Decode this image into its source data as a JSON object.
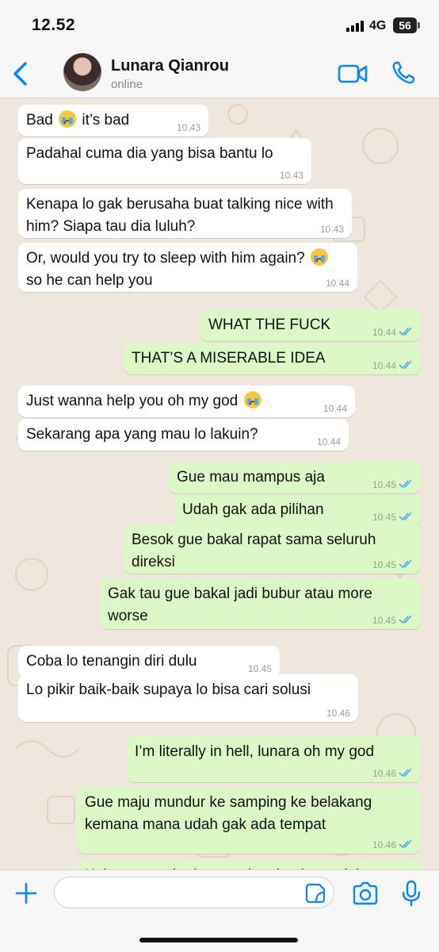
{
  "status_bar": {
    "time": "12.52",
    "network": "4G",
    "battery": "56"
  },
  "header": {
    "name": "Lunara Qianrou",
    "status": "online"
  },
  "input": {
    "placeholder": ""
  },
  "messages": [
    {
      "dir": "in",
      "text": "Bad {e} it’s bad",
      "time": "10.43"
    },
    {
      "dir": "in",
      "text": "Padahal cuma dia yang bisa bantu lo",
      "time": "10.43"
    },
    {
      "dir": "in",
      "text": "Kenapa lo gak berusaha buat talking nice with him? Siapa tau dia luluh?",
      "time": "10.43"
    },
    {
      "dir": "in",
      "text": "Or, would you try to sleep with him again? {e} so he can help you",
      "time": "10.44"
    },
    {
      "dir": "out",
      "text": "WHAT THE FUCK",
      "time": "10.44"
    },
    {
      "dir": "out",
      "text": "THAT’S A MISERABLE IDEA",
      "time": "10.44"
    },
    {
      "dir": "in",
      "text": "Just wanna help you oh my god {e}",
      "time": "10.44"
    },
    {
      "dir": "in",
      "text": "Sekarang apa yang mau lo lakuin?",
      "time": "10.44"
    },
    {
      "dir": "out",
      "text": "Gue mau mampus aja",
      "time": "10.45"
    },
    {
      "dir": "out",
      "text": "Udah gak ada pilihan",
      "time": "10.45"
    },
    {
      "dir": "out",
      "text": "Besok gue bakal rapat sama seluruh direksi",
      "time": "10.45"
    },
    {
      "dir": "out",
      "text": "Gak tau gue bakal jadi bubur atau more worse",
      "time": "10.45"
    },
    {
      "dir": "in",
      "text": "Coba lo tenangin diri dulu",
      "time": "10.45"
    },
    {
      "dir": "in",
      "text": "Lo pikir baik-baik supaya lo bisa cari solusi",
      "time": "10.46"
    },
    {
      "dir": "out",
      "text": "I’m literally in hell, lunara oh my god",
      "time": "10.46"
    },
    {
      "dir": "out",
      "text": "Gue maju mundur ke samping ke belakang kemana mana udah gak ada tempat",
      "time": "10.46"
    },
    {
      "dir": "out",
      "text": "Kalau sampai ada rapat komisaris setelah",
      "time": ""
    }
  ],
  "icons": {
    "back": "chevron-left-icon",
    "video": "video-call-icon",
    "call": "phone-icon",
    "plus": "plus-icon",
    "sticker": "sticker-icon",
    "camera": "camera-icon",
    "mic": "microphone-icon",
    "read_receipt": "double-check-icon",
    "emoji": "loudly-crying-face"
  },
  "colors": {
    "accent": "#0a84ff",
    "incoming": "#ffffff",
    "outgoing": "#dcf8c6",
    "wallpaper": "#efe7dd",
    "read_tick": "#4fa7e8"
  }
}
